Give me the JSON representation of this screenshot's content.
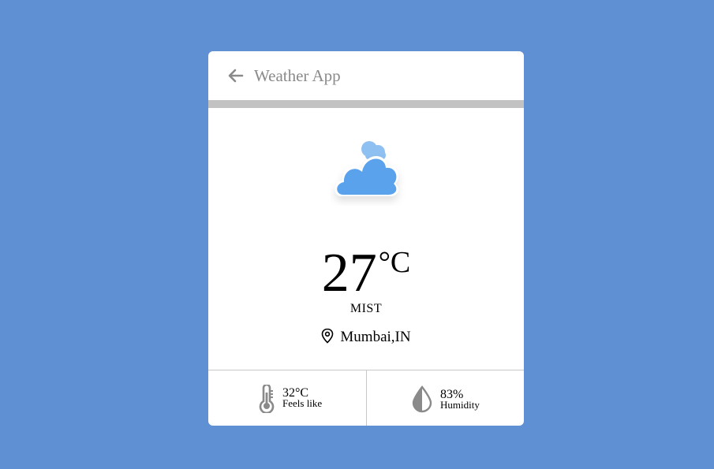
{
  "header": {
    "title": "Weather App",
    "back_icon": "arrow-left-icon"
  },
  "weather": {
    "icon": "cloudy-icon",
    "temperature": "27",
    "unit": "°C",
    "condition": "MIST",
    "location": "Mumbai,IN"
  },
  "stats": {
    "feels_like": {
      "value": "32°C",
      "label": "Feels like",
      "icon": "thermometer-icon"
    },
    "humidity": {
      "value": "83%",
      "label": "Humidity",
      "icon": "droplet-icon"
    }
  },
  "colors": {
    "background": "#6090d4",
    "card": "#ffffff",
    "cloud": "#5aa2ec",
    "cloud_light": "#8fc0f2",
    "muted": "#8a8a8a"
  }
}
